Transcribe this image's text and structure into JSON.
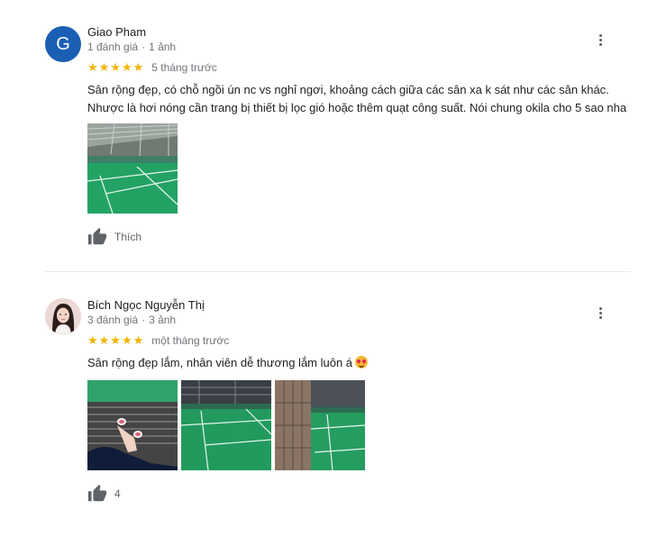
{
  "reviews": [
    {
      "avatar_letter": "G",
      "name": "Giao Pham",
      "review_count": "1 đánh giá",
      "photo_count": "1 ảnh",
      "stars": "★★★★★",
      "rating": 5,
      "time": "5 tháng trước",
      "text": "Sân rộng đẹp, có chỗ ngồi ún nc vs nghỉ ngơi, khoảng cách giữa các sân xa k sát như các sân khác. Nhược là hơi nóng cần trang bị thiết bị lọc gió hoặc thêm quạt công suất. Nói chung okila cho 5 sao nha",
      "like_label": "Thích"
    },
    {
      "name": "Bích Ngọc Nguyễn Thị",
      "review_count": "3 đánh giá",
      "photo_count": "3 ảnh",
      "stars": "★★★★★",
      "rating": 5,
      "time": "một tháng trước",
      "text": "Sân rộng đẹp lắm, nhân viên dễ thương lắm luôn á",
      "like_count": "4"
    }
  ],
  "colors": {
    "star": "#f2b400",
    "avatar_bg": "#1a5fb4",
    "court_green": "#2a9a5c",
    "muted_text": "#70757a"
  },
  "icons": [
    "more-vert-icon",
    "thumb-up-icon",
    "star-eyes-emoji"
  ]
}
